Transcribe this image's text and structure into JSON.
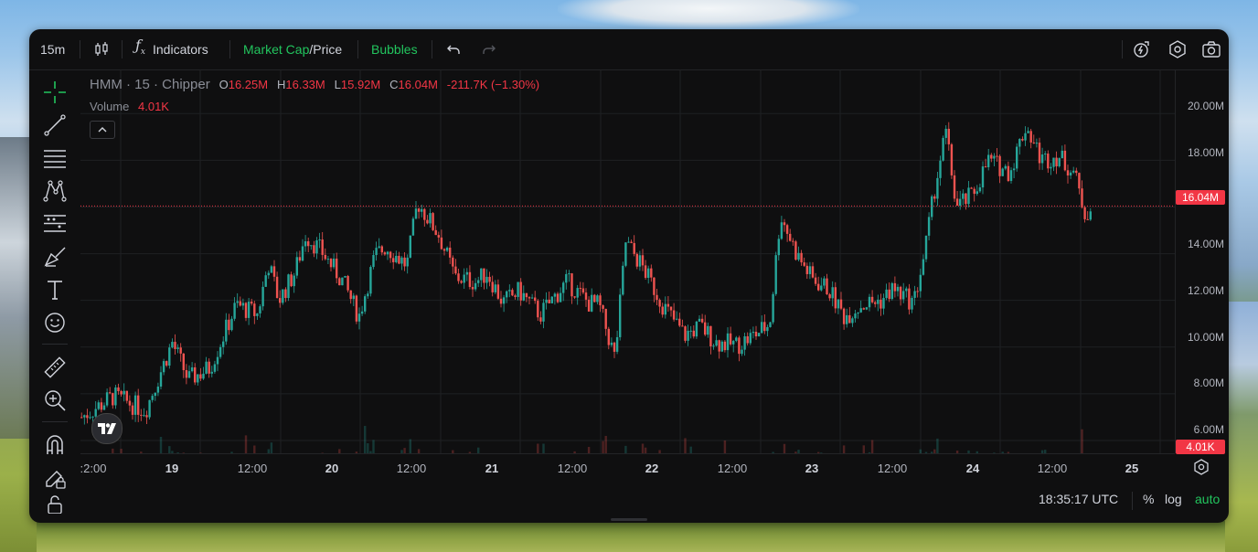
{
  "toolbar": {
    "interval": "15m",
    "indicators_label": "Indicators",
    "marketcap_label": "Market Cap",
    "price_label": "/Price",
    "bubbles_label": "Bubbles"
  },
  "legend": {
    "title": "HMM · 15 · Chipper",
    "open_key": "O",
    "open_val": "16.25M",
    "high_key": "H",
    "high_val": "16.33M",
    "low_key": "L",
    "low_val": "15.92M",
    "close_key": "C",
    "close_val": "16.04M",
    "change": "-211.7K (−1.30%)",
    "volume_label": "Volume",
    "volume_val": "4.01K"
  },
  "price_axis": {
    "labels": [
      "20.00M",
      "18.00M",
      "16.00M",
      "14.00M",
      "12.00M",
      "10.00M",
      "8.00M",
      "6.00M"
    ],
    "current_price": "16.04M",
    "current_volume": "4.01K"
  },
  "time_axis": {
    "labels": [
      ":2:00",
      "19",
      "12:00",
      "20",
      "12:00",
      "21",
      "12:00",
      "22",
      "12:00",
      "23",
      "12:00",
      "24",
      "12:00",
      "25"
    ]
  },
  "status": {
    "clock": "18:35:17 UTC",
    "percent": "%",
    "log": "log",
    "auto": "auto"
  },
  "colors": {
    "up": "#26a69a",
    "down": "#ef5350",
    "accent_green": "#22c55e",
    "price_line": "#f23645"
  },
  "chart_data": {
    "type": "candlestick",
    "title": "HMM · 15 · Chipper",
    "x": [
      "18 12:00",
      "19 00:00",
      "19 12:00",
      "20 00:00",
      "20 12:00",
      "21 00:00",
      "21 12:00",
      "22 00:00",
      "22 12:00",
      "23 00:00",
      "23 12:00",
      "24 00:00",
      "24 12:00",
      "25 00:00"
    ],
    "close_path_millions": [
      [
        0,
        7.0
      ],
      [
        0.3,
        7.9
      ],
      [
        0.6,
        7.3
      ],
      [
        0.85,
        10.2
      ],
      [
        1.0,
        8.6
      ],
      [
        1.2,
        9.1
      ],
      [
        1.45,
        11.8
      ],
      [
        1.65,
        11.4
      ],
      [
        1.75,
        13.6
      ],
      [
        1.85,
        12.0
      ],
      [
        2.0,
        13.2
      ],
      [
        2.1,
        14.8
      ],
      [
        2.25,
        14.1
      ],
      [
        2.45,
        12.8
      ],
      [
        2.6,
        11.3
      ],
      [
        2.75,
        13.9
      ],
      [
        2.85,
        14.3
      ],
      [
        3.05,
        13.5
      ],
      [
        3.15,
        16.2
      ],
      [
        3.35,
        14.8
      ],
      [
        3.5,
        13.0
      ],
      [
        3.7,
        12.8
      ],
      [
        3.8,
        13.2
      ],
      [
        3.95,
        11.9
      ],
      [
        4.1,
        12.4
      ],
      [
        4.3,
        11.4
      ],
      [
        4.55,
        12.8
      ],
      [
        4.75,
        11.9
      ],
      [
        4.85,
        11.8
      ],
      [
        5.0,
        9.5
      ],
      [
        5.1,
        14.5
      ],
      [
        5.25,
        13.5
      ],
      [
        5.45,
        11.8
      ],
      [
        5.65,
        10.5
      ],
      [
        5.8,
        10.9
      ],
      [
        5.95,
        10.2
      ],
      [
        6.15,
        10.1
      ],
      [
        6.3,
        10.5
      ],
      [
        6.45,
        11.0
      ],
      [
        6.55,
        15.7
      ],
      [
        6.7,
        14.0
      ],
      [
        6.85,
        12.9
      ],
      [
        7.0,
        12.5
      ],
      [
        7.15,
        11.3
      ],
      [
        7.3,
        11.8
      ],
      [
        7.5,
        12.0
      ],
      [
        7.6,
        12.5
      ],
      [
        7.8,
        11.9
      ],
      [
        7.9,
        14.0
      ],
      [
        8.0,
        16.9
      ],
      [
        8.1,
        19.2
      ],
      [
        8.2,
        16.0
      ],
      [
        8.35,
        16.5
      ],
      [
        8.5,
        18.0
      ],
      [
        8.7,
        17.5
      ],
      [
        8.85,
        19.5
      ],
      [
        9.0,
        18.0
      ],
      [
        9.15,
        18.2
      ],
      [
        9.3,
        17.5
      ],
      [
        9.4,
        15.8
      ],
      [
        9.55,
        16.04
      ]
    ],
    "ylim": [
      6.0,
      20.5
    ],
    "y_ticks": [
      "6.00M",
      "8.00M",
      "10.00M",
      "12.00M",
      "14.00M",
      "16.00M",
      "18.00M",
      "20.00M"
    ],
    "last_price": 16.04,
    "volume_unit": "K"
  }
}
